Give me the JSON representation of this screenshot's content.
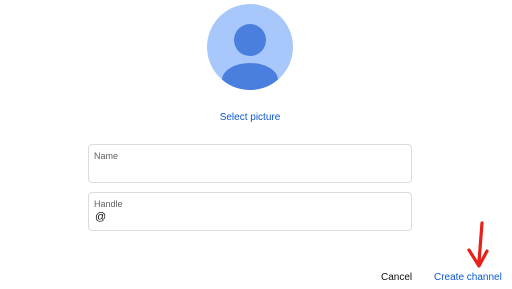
{
  "avatar": {
    "icon": "person-icon",
    "background_color": "#a8c7fa",
    "figure_color": "#4285f4"
  },
  "select_picture_label": "Select picture",
  "name_field": {
    "label": "Name",
    "value": ""
  },
  "handle_field": {
    "label": "Handle",
    "prefix": "@",
    "value": ""
  },
  "actions": {
    "cancel_label": "Cancel",
    "create_label": "Create channel"
  },
  "annotation": {
    "icon": "red-arrow-icon",
    "color": "#e8201a"
  },
  "colors": {
    "accent": "#0b57d0",
    "text": "#0f0f0f",
    "border": "#dadce0"
  }
}
